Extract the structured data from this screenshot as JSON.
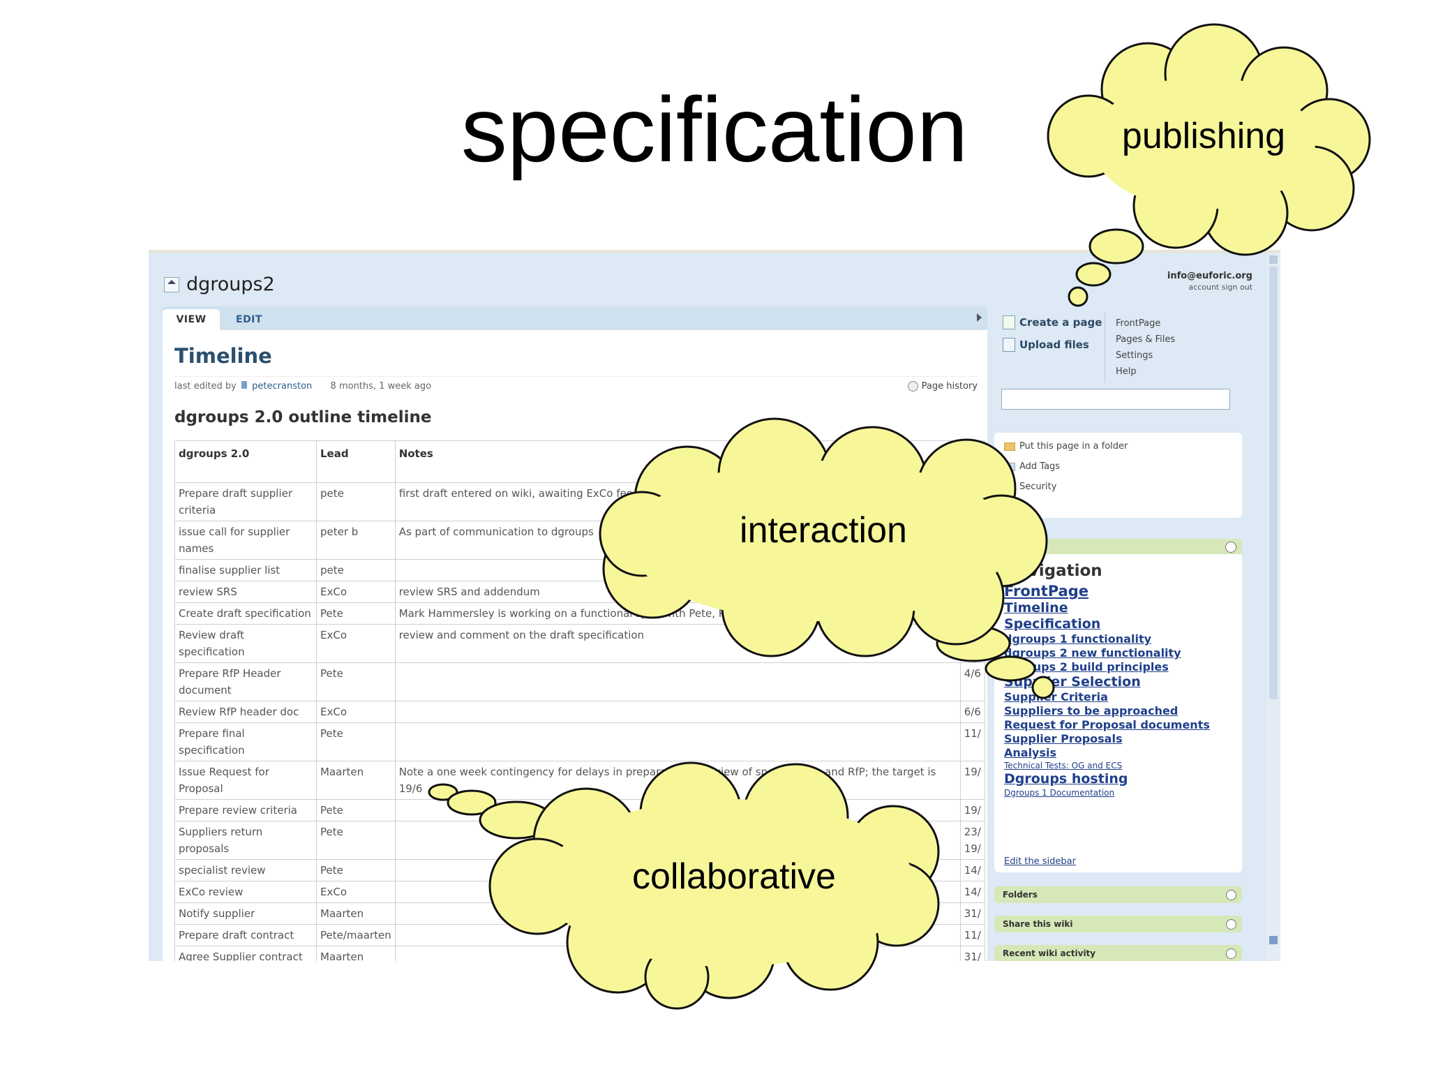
{
  "slide": {
    "title": "specification"
  },
  "clouds": {
    "publishing": "publishing",
    "interaction": "interaction",
    "collaborative": "collaborative"
  },
  "app": {
    "name": "dgroups2"
  },
  "tabs": {
    "view": "VIEW",
    "edit": "EDIT"
  },
  "page": {
    "title": "Timeline",
    "last_edited_prefix": "last edited by",
    "last_edited_user": "petecranston",
    "last_edited_time": "8 months, 1 week ago",
    "history": "Page history",
    "heading": "dgroups 2.0 outline timeline"
  },
  "table": {
    "headers": [
      "dgroups 2.0",
      "Lead",
      "Notes",
      ""
    ],
    "rows": [
      [
        "Prepare draft supplier criteria",
        "pete",
        "first draft entered on wiki, awaiting ExCo feed",
        ""
      ],
      [
        "issue call for supplier names",
        "peter b",
        "As part of communication to dgroups",
        ""
      ],
      [
        "finalise supplier list",
        "pete",
        "",
        ""
      ],
      [
        "review SRS",
        "ExCo",
        "review SRS and addendum",
        ""
      ],
      [
        "Create draft specification",
        "Pete",
        "Mark Hammersley is working on a functional spec with Pete, Peter B and Sarah Kerr to clarify his ideas",
        ""
      ],
      [
        "Review draft specification",
        "ExCo",
        "review and comment on the draft specification",
        ""
      ],
      [
        "Prepare RfP Header document",
        "Pete",
        "",
        "4/6"
      ],
      [
        "Review RfP header doc",
        "ExCo",
        "",
        "6/6"
      ],
      [
        "Prepare final specification",
        "Pete",
        "",
        "11/"
      ],
      [
        "Issue Request for Proposal",
        "Maarten",
        "Note a one week contingency for delays in preparation or review of specification and RfP; the target is 19/6",
        "19/"
      ],
      [
        "Prepare review criteria",
        "Pete",
        "",
        "19/"
      ],
      [
        "Suppliers return proposals",
        "Pete",
        "",
        "23/ 19/"
      ],
      [
        "specialist review",
        "Pete",
        "",
        "14/"
      ],
      [
        "ExCo review",
        "ExCo",
        "",
        "14/"
      ],
      [
        "Notify supplier",
        "Maarten",
        "",
        "31/"
      ],
      [
        "Prepare draft contract",
        "Pete/maarten",
        "",
        "11/"
      ],
      [
        "Agree Supplier contract",
        "Maarten",
        "",
        "31/"
      ]
    ]
  },
  "account": {
    "email": "info@euforic.org",
    "links": "account   sign out"
  },
  "actions": {
    "create": "Create a page",
    "upload": "Upload files"
  },
  "quicklinks": [
    "FrontPage",
    "Pages & Files",
    "Settings",
    "Help"
  ],
  "page_actions": {
    "folder": "Put this page in a folder",
    "tags": "Add Tags",
    "security": "Security"
  },
  "navigation": {
    "title": "Navigation",
    "items": [
      "FrontPage",
      "Timeline",
      "Specification",
      "dgroups 1 functionality",
      "dgroups 2 new functionality",
      "dgroups 2 build principles",
      "Supplier Selection",
      "Supplier Criteria",
      "Suppliers to be approached",
      "Request for Proposal documents",
      "Supplier Proposals",
      "Analysis",
      "Technical Tests: OG and ECS",
      "Dgroups hosting",
      "Dgroups 1 Documentation"
    ],
    "edit_sidebar": "Edit the sidebar"
  },
  "sidebar_sections": {
    "folders": "Folders",
    "share": "Share this wiki",
    "recent": "Recent wiki activity"
  },
  "colors": {
    "cloud_fill": "#f7f79a",
    "link": "#1f3f8a",
    "title": "#2b4f6e"
  }
}
